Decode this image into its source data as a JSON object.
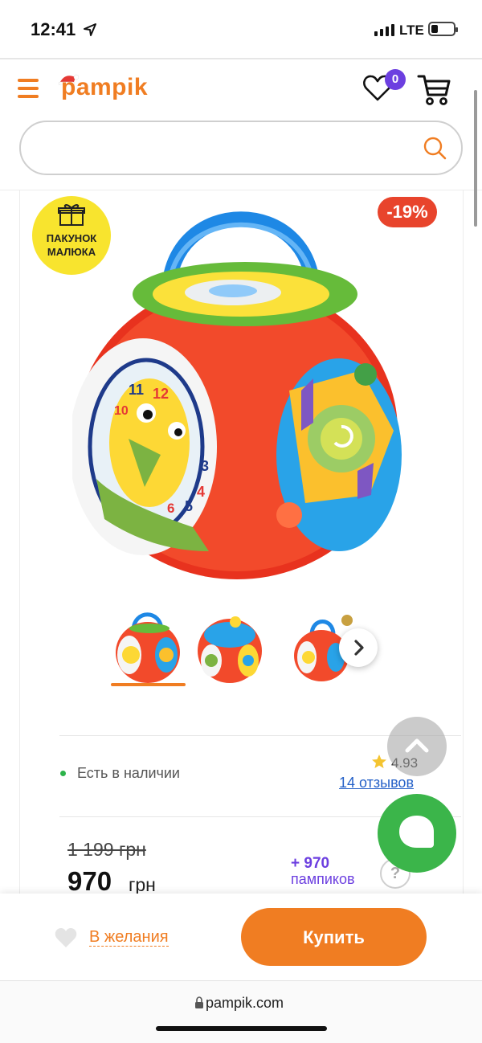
{
  "status_bar": {
    "time": "12:41",
    "network": "LTE",
    "battery_level": 0.25
  },
  "header": {
    "logo_text": "pampik",
    "wishlist_count": "0",
    "brand_color": "#f07d22"
  },
  "search": {
    "placeholder": "",
    "value": ""
  },
  "product": {
    "gift_badge": "ПАКУНОК\nМАЛЮКА",
    "discount": "-19%",
    "availability": "Есть в наличии",
    "rating": "4.93",
    "reviews": "14 отзывов",
    "old_price": "1 199 грн",
    "price": "970",
    "currency": "грн",
    "bonus_amount": "+ 970",
    "bonus_label": "пампиков",
    "help": "?",
    "thumbnails": [
      "thumb-1",
      "thumb-2",
      "thumb-3"
    ],
    "selected_thumbnail": 0
  },
  "actions": {
    "wishlist_label": "В желания",
    "buy_label": "Купить"
  },
  "browser": {
    "url": "pampik.com"
  },
  "colors": {
    "accent": "#f07d22",
    "discount": "#e8442c",
    "bonus": "#6c3fe0",
    "chat": "#3bb54a",
    "link": "#2460c8"
  }
}
